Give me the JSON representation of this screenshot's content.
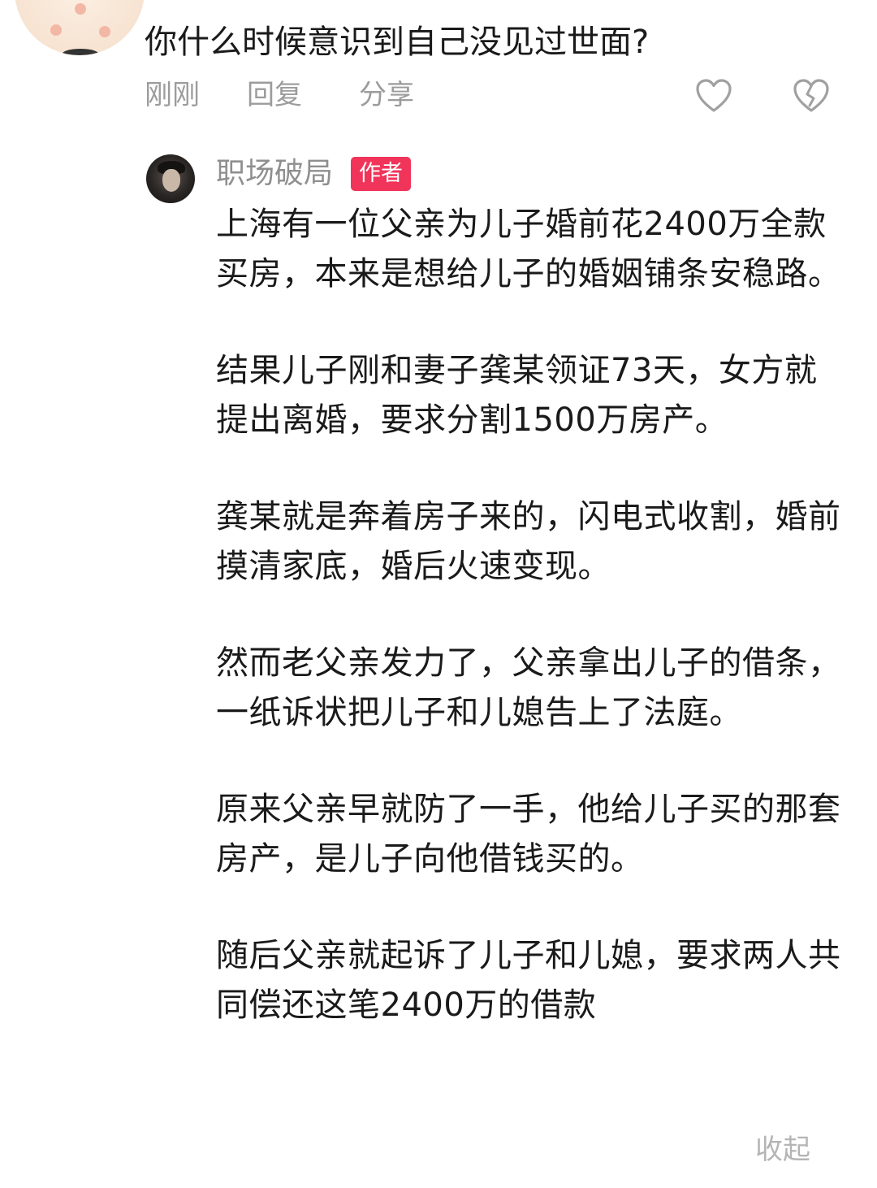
{
  "question": "你什么时候意识到自己没见过世面?",
  "meta": {
    "time": "刚刚",
    "reply_label": "回复",
    "share_label": "分享"
  },
  "icons": {
    "like": "heart-outline-icon",
    "dislike": "broken-heart-icon"
  },
  "author": {
    "name": "职场破局",
    "badge": "作者",
    "badge_color": "#f0345a"
  },
  "paragraphs": [
    "上海有一位父亲为儿子婚前花2400万全款买房，本来是想给儿子的婚姻铺条安稳路。",
    "结果儿子刚和妻子龚某领证73天，女方就提出离婚，要求分割1500万房产。",
    "龚某就是奔着房子来的，闪电式收割，婚前摸清家底，婚后火速变现。",
    "然而老父亲发力了，父亲拿出儿子的借条，一纸诉状把儿子和儿媳告上了法庭。",
    "原来父亲早就防了一手，他给儿子买的那套房产，是儿子向他借钱买的。",
    "随后父亲就起诉了儿子和儿媳，要求两人共同偿还这笔2400万的借款"
  ],
  "collapse_label": "收起"
}
